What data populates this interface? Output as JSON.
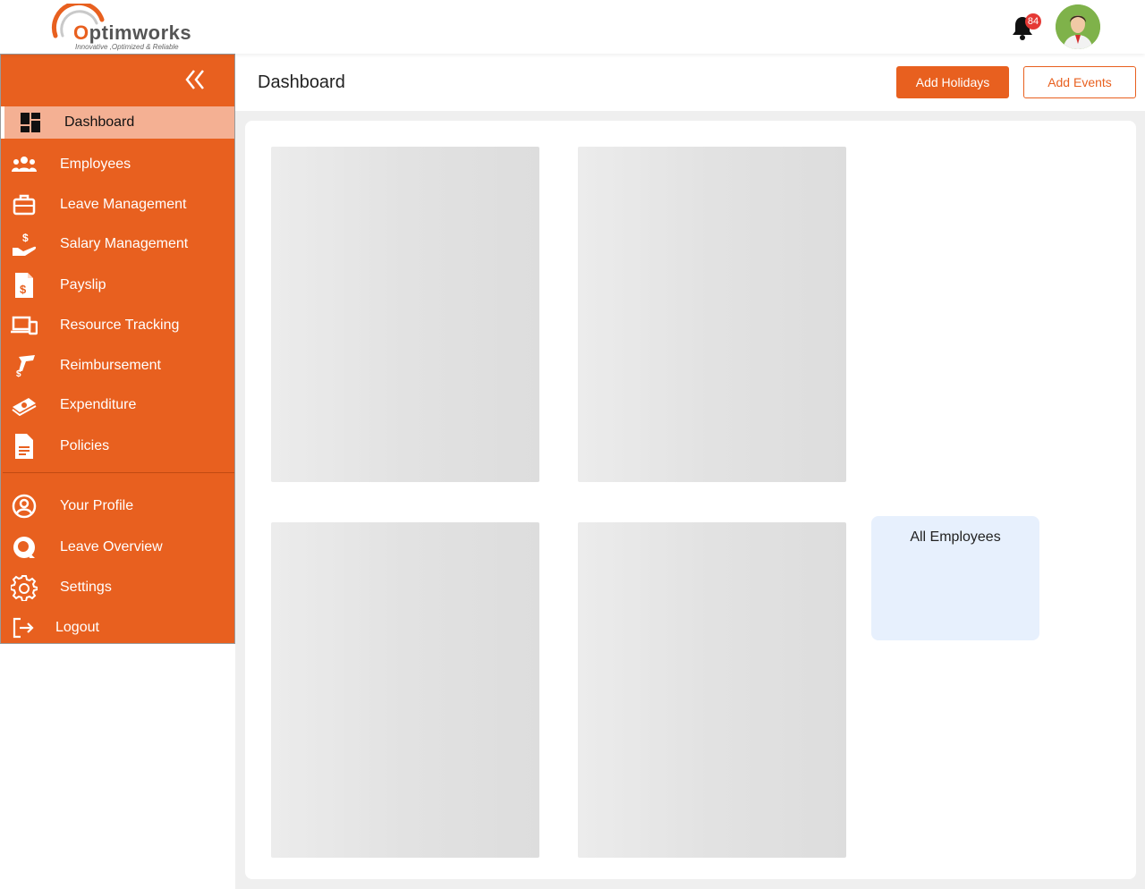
{
  "brand": {
    "name_accent": "O",
    "name_rest": "ptimworks",
    "tagline": "Innovative ,Optimized & Reliable"
  },
  "header": {
    "notification_count": "84"
  },
  "sidebar": {
    "items": [
      {
        "label": "Dashboard",
        "icon": "dashboard-icon",
        "active": true
      },
      {
        "label": "Employees",
        "icon": "users-icon"
      },
      {
        "label": "Leave Management",
        "icon": "briefcase-icon"
      },
      {
        "label": "Salary Management",
        "icon": "salary-hand-icon"
      },
      {
        "label": "Payslip",
        "icon": "payslip-icon"
      },
      {
        "label": "Resource Tracking",
        "icon": "devices-icon"
      },
      {
        "label": "Reimbursement",
        "icon": "reimbursement-icon"
      },
      {
        "label": "Expenditure",
        "icon": "money-stack-icon"
      },
      {
        "label": "Policies",
        "icon": "document-icon"
      }
    ],
    "secondary_items": [
      {
        "label": "Your Profile",
        "icon": "profile-icon"
      },
      {
        "label": "Leave Overview",
        "icon": "leave-overview-icon"
      },
      {
        "label": "Settings",
        "icon": "gear-icon"
      },
      {
        "label": "Logout",
        "icon": "logout-icon"
      }
    ]
  },
  "page": {
    "title": "Dashboard",
    "add_holidays_label": "Add Holidays",
    "add_events_label": "Add Events"
  },
  "cards": {
    "all_employees_title": "All Employees"
  },
  "colors": {
    "accent": "#e8601f",
    "active_item_bg": "#f4b093",
    "badge": "#e53935",
    "employee_card_bg": "#e7f0fd"
  }
}
